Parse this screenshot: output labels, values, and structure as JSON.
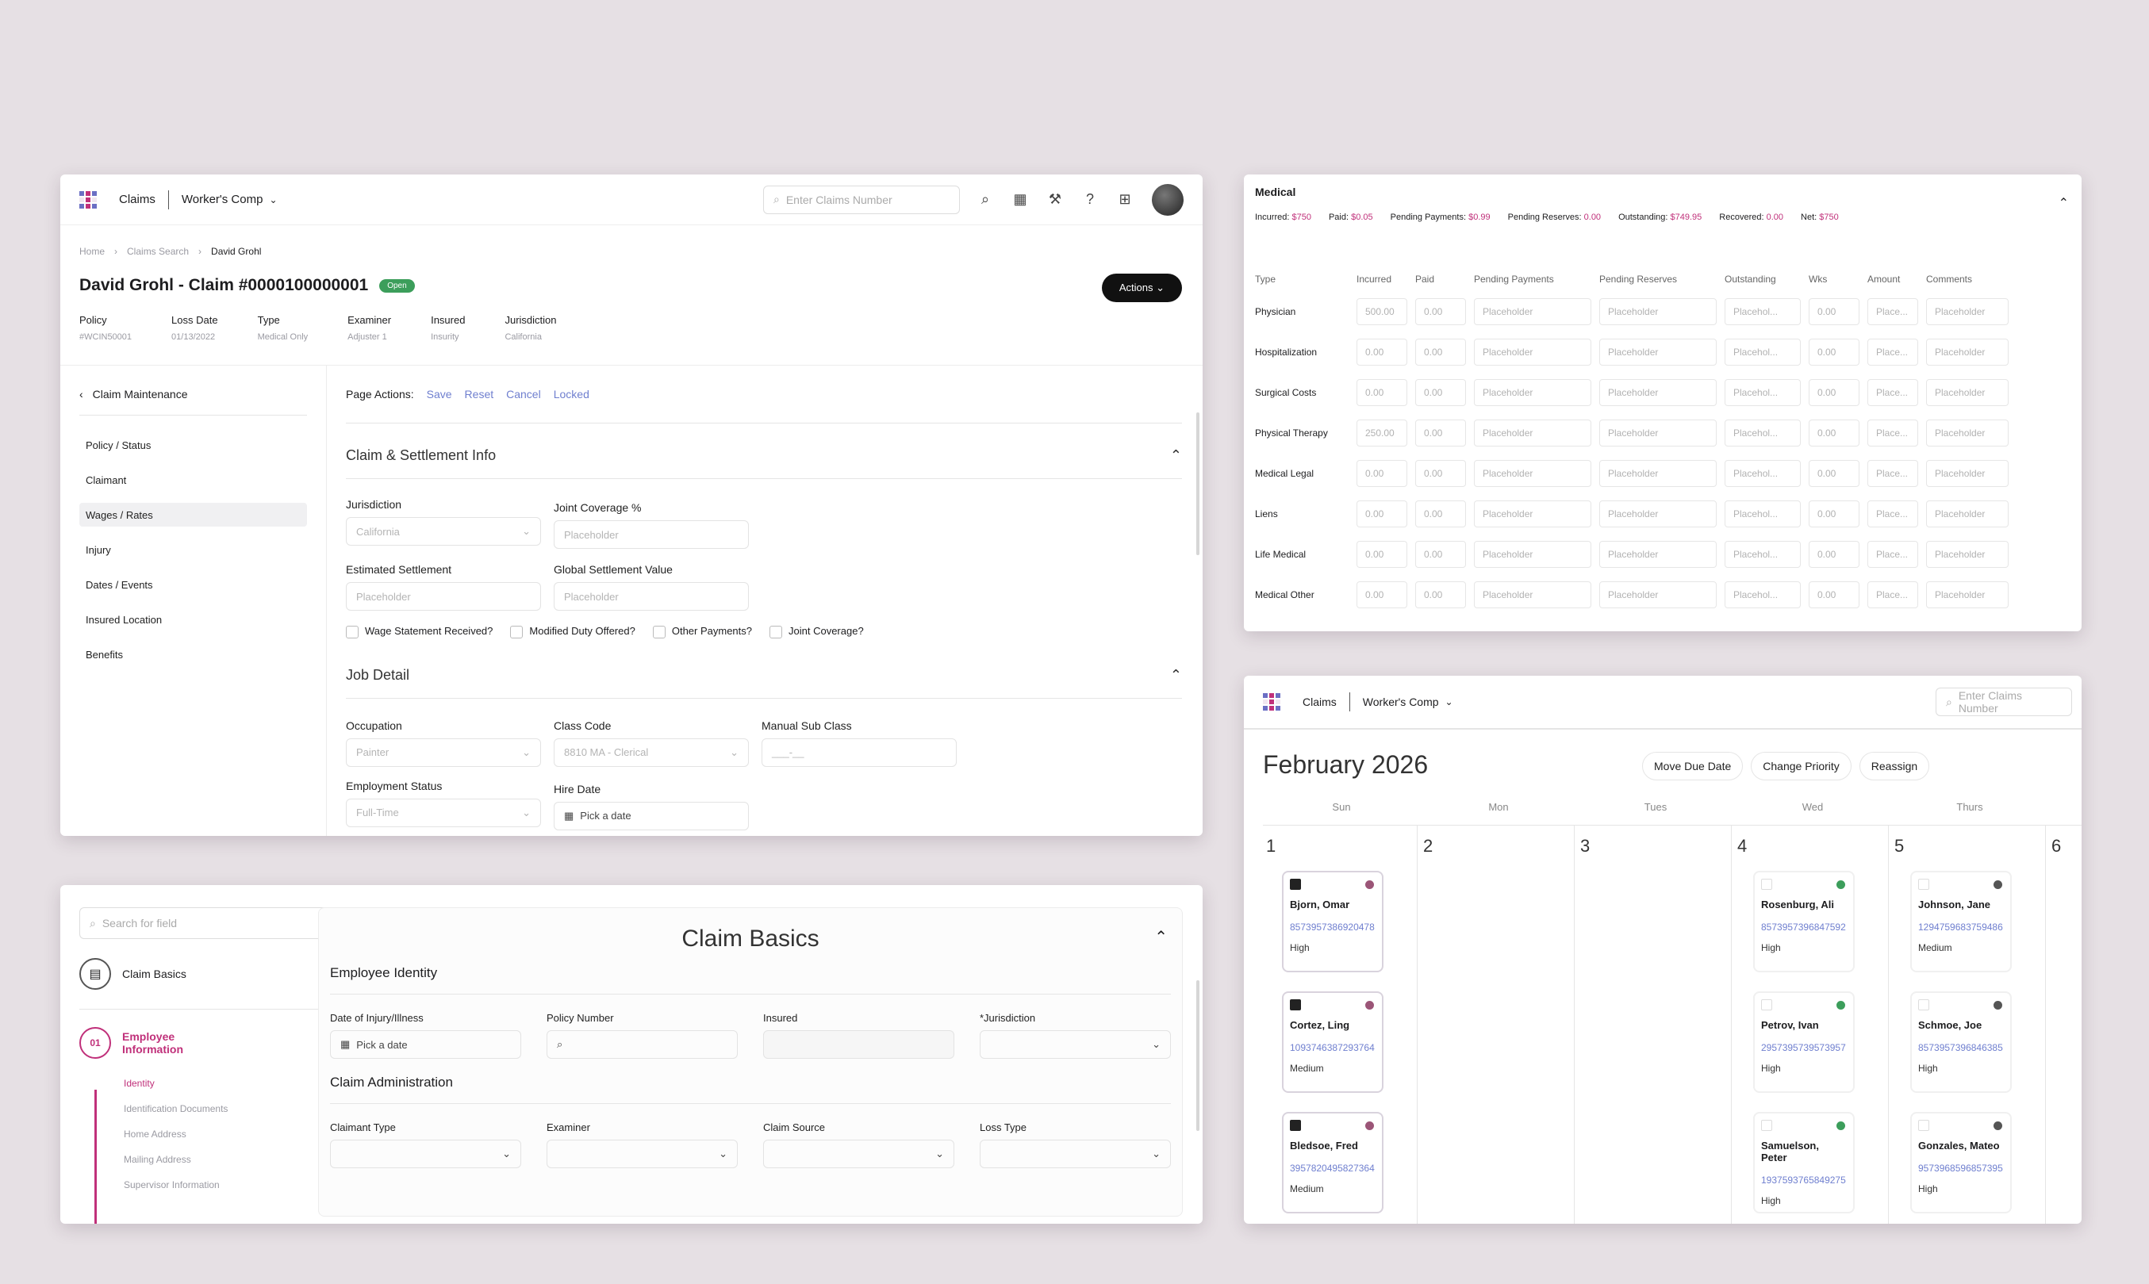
{
  "claim_panel": {
    "app": "Claims",
    "module": "Worker's Comp",
    "search_placeholder": "Enter Claims Number",
    "breadcrumb": [
      "Home",
      "Claims Search",
      "David Grohl"
    ],
    "title": "David Grohl - Claim #0000100000001",
    "status": "Open",
    "actions_label": "Actions",
    "meta": [
      {
        "label": "Policy",
        "value": "#WCIN50001"
      },
      {
        "label": "Loss Date",
        "value": "01/13/2022"
      },
      {
        "label": "Type",
        "value": "Medical Only"
      },
      {
        "label": "Examiner",
        "value": "Adjuster 1"
      },
      {
        "label": "Insured",
        "value": "Insurity"
      },
      {
        "label": "Jurisdiction",
        "value": "California"
      }
    ],
    "sidebar_back": "Claim Maintenance",
    "sidebar": [
      "Policy / Status",
      "Claimant",
      "Wages / Rates",
      "Injury",
      "Dates / Events",
      "Insured Location",
      "Benefits"
    ],
    "page_actions_label": "Page Actions:",
    "page_actions": [
      "Save",
      "Reset",
      "Cancel",
      "Locked"
    ],
    "section1": "Claim & Settlement Info",
    "jurisdiction_label": "Jurisdiction",
    "jurisdiction_value": "California",
    "joint_cov_label": "Joint Coverage %",
    "placeholder": "Placeholder",
    "est_settle_label": "Estimated Settlement",
    "global_settle_label": "Global Settlement Value",
    "checkboxes": [
      "Wage Statement Received?",
      "Modified Duty Offered?",
      "Other Payments?",
      "Joint Coverage?"
    ],
    "section2": "Job Detail",
    "occupation_label": "Occupation",
    "occupation_value": "Painter",
    "class_code_label": "Class Code",
    "class_code_value": "8810 MA - Clerical",
    "manual_sub_label": "Manual Sub Class",
    "manual_sub_value": "___-__",
    "emp_status_label": "Employment Status",
    "emp_status_value": "Full-Time",
    "hire_date_label": "Hire Date",
    "pick_date": "Pick a date"
  },
  "basics_panel": {
    "search_placeholder": "Search for field",
    "step1": "Claim Basics",
    "step2_num": "01",
    "step2": "Employee Information",
    "substeps": [
      "Identity",
      "Identification Documents",
      "Home Address",
      "Mailing Address",
      "Supervisor Information"
    ],
    "title": "Claim Basics",
    "section1": "Employee Identity",
    "doi_label": "Date of Injury/Illness",
    "pick_date": "Pick a date",
    "policy_label": "Policy Number",
    "insured_label": "Insured",
    "jurisdiction_label": "*Jurisdiction",
    "section2": "Claim Administration",
    "claimant_type_label": "Claimant Type",
    "examiner_label": "Examiner",
    "claim_source_label": "Claim Source",
    "loss_type_label": "Loss Type"
  },
  "medical_panel": {
    "title": "Medical",
    "summary": [
      {
        "label": "Incurred:",
        "value": "$750"
      },
      {
        "label": "Paid:",
        "value": "$0.05"
      },
      {
        "label": "Pending Payments:",
        "value": "$0.99"
      },
      {
        "label": "Pending Reserves:",
        "value": "0.00"
      },
      {
        "label": "Outstanding:",
        "value": "$749.95"
      },
      {
        "label": "Recovered:",
        "value": "0.00"
      },
      {
        "label": "Net:",
        "value": "$750"
      }
    ],
    "columns": [
      "Type",
      "Incurred",
      "Paid",
      "Pending Payments",
      "Pending Reserves",
      "Outstanding",
      "Wks",
      "Amount",
      "Comments"
    ],
    "rows": [
      {
        "type": "Physician",
        "incurred": "500.00",
        "paid": "0.00"
      },
      {
        "type": "Hospitalization",
        "incurred": "0.00",
        "paid": "0.00"
      },
      {
        "type": "Surgical Costs",
        "incurred": "0.00",
        "paid": "0.00"
      },
      {
        "type": "Physical Therapy",
        "incurred": "250.00",
        "paid": "0.00"
      },
      {
        "type": "Medical Legal",
        "incurred": "0.00",
        "paid": "0.00"
      },
      {
        "type": "Liens",
        "incurred": "0.00",
        "paid": "0.00"
      },
      {
        "type": "Life Medical",
        "incurred": "0.00",
        "paid": "0.00"
      },
      {
        "type": "Medical Other",
        "incurred": "0.00",
        "paid": "0.00"
      }
    ],
    "placeholder": "Placeholder",
    "placeholder_short": "Placehol...",
    "place_short": "Place...",
    "wks": "0.00"
  },
  "calendar_panel": {
    "app": "Claims",
    "module": "Worker's Comp",
    "search_placeholder": "Enter Claims Number",
    "month": "February 2026",
    "buttons": [
      "Move Due Date",
      "Change Priority",
      "Reassign"
    ],
    "days": [
      "Sun",
      "Mon",
      "Tues",
      "Wed",
      "Thurs"
    ],
    "dates": [
      "1",
      "2",
      "3",
      "4",
      "5",
      "6"
    ],
    "cards": [
      {
        "col": 0,
        "row": 0,
        "name": "Bjorn, Omar",
        "num": "8573957386920478",
        "priority": "High",
        "checked": true,
        "dot": "#9b5577"
      },
      {
        "col": 0,
        "row": 1,
        "name": "Cortez, Ling",
        "num": "1093746387293764",
        "priority": "Medium",
        "checked": true,
        "dot": "#9b5577"
      },
      {
        "col": 0,
        "row": 2,
        "name": "Bledsoe, Fred",
        "num": "3957820495827364",
        "priority": "Medium",
        "checked": true,
        "dot": "#9b5577"
      },
      {
        "col": 3,
        "row": 0,
        "name": "Rosenburg, Ali",
        "num": "8573957396847592",
        "priority": "High",
        "checked": false,
        "dot": "#3c9e5b"
      },
      {
        "col": 3,
        "row": 1,
        "name": "Petrov, Ivan",
        "num": "2957395739573957",
        "priority": "High",
        "checked": false,
        "dot": "#3c9e5b"
      },
      {
        "col": 3,
        "row": 2,
        "name": "Samuelson, Peter",
        "num": "1937593765849275",
        "priority": "High",
        "checked": false,
        "dot": "#3c9e5b"
      },
      {
        "col": 4,
        "row": 0,
        "name": "Johnson, Jane",
        "num": "1294759683759486",
        "priority": "Medium",
        "checked": false,
        "dot": "#555"
      },
      {
        "col": 4,
        "row": 1,
        "name": "Schmoe, Joe",
        "num": "8573957396846385",
        "priority": "High",
        "checked": false,
        "dot": "#555"
      },
      {
        "col": 4,
        "row": 2,
        "name": "Gonzales, Mateo",
        "num": "9573968596857395",
        "priority": "High",
        "checked": false,
        "dot": "#555"
      }
    ]
  }
}
